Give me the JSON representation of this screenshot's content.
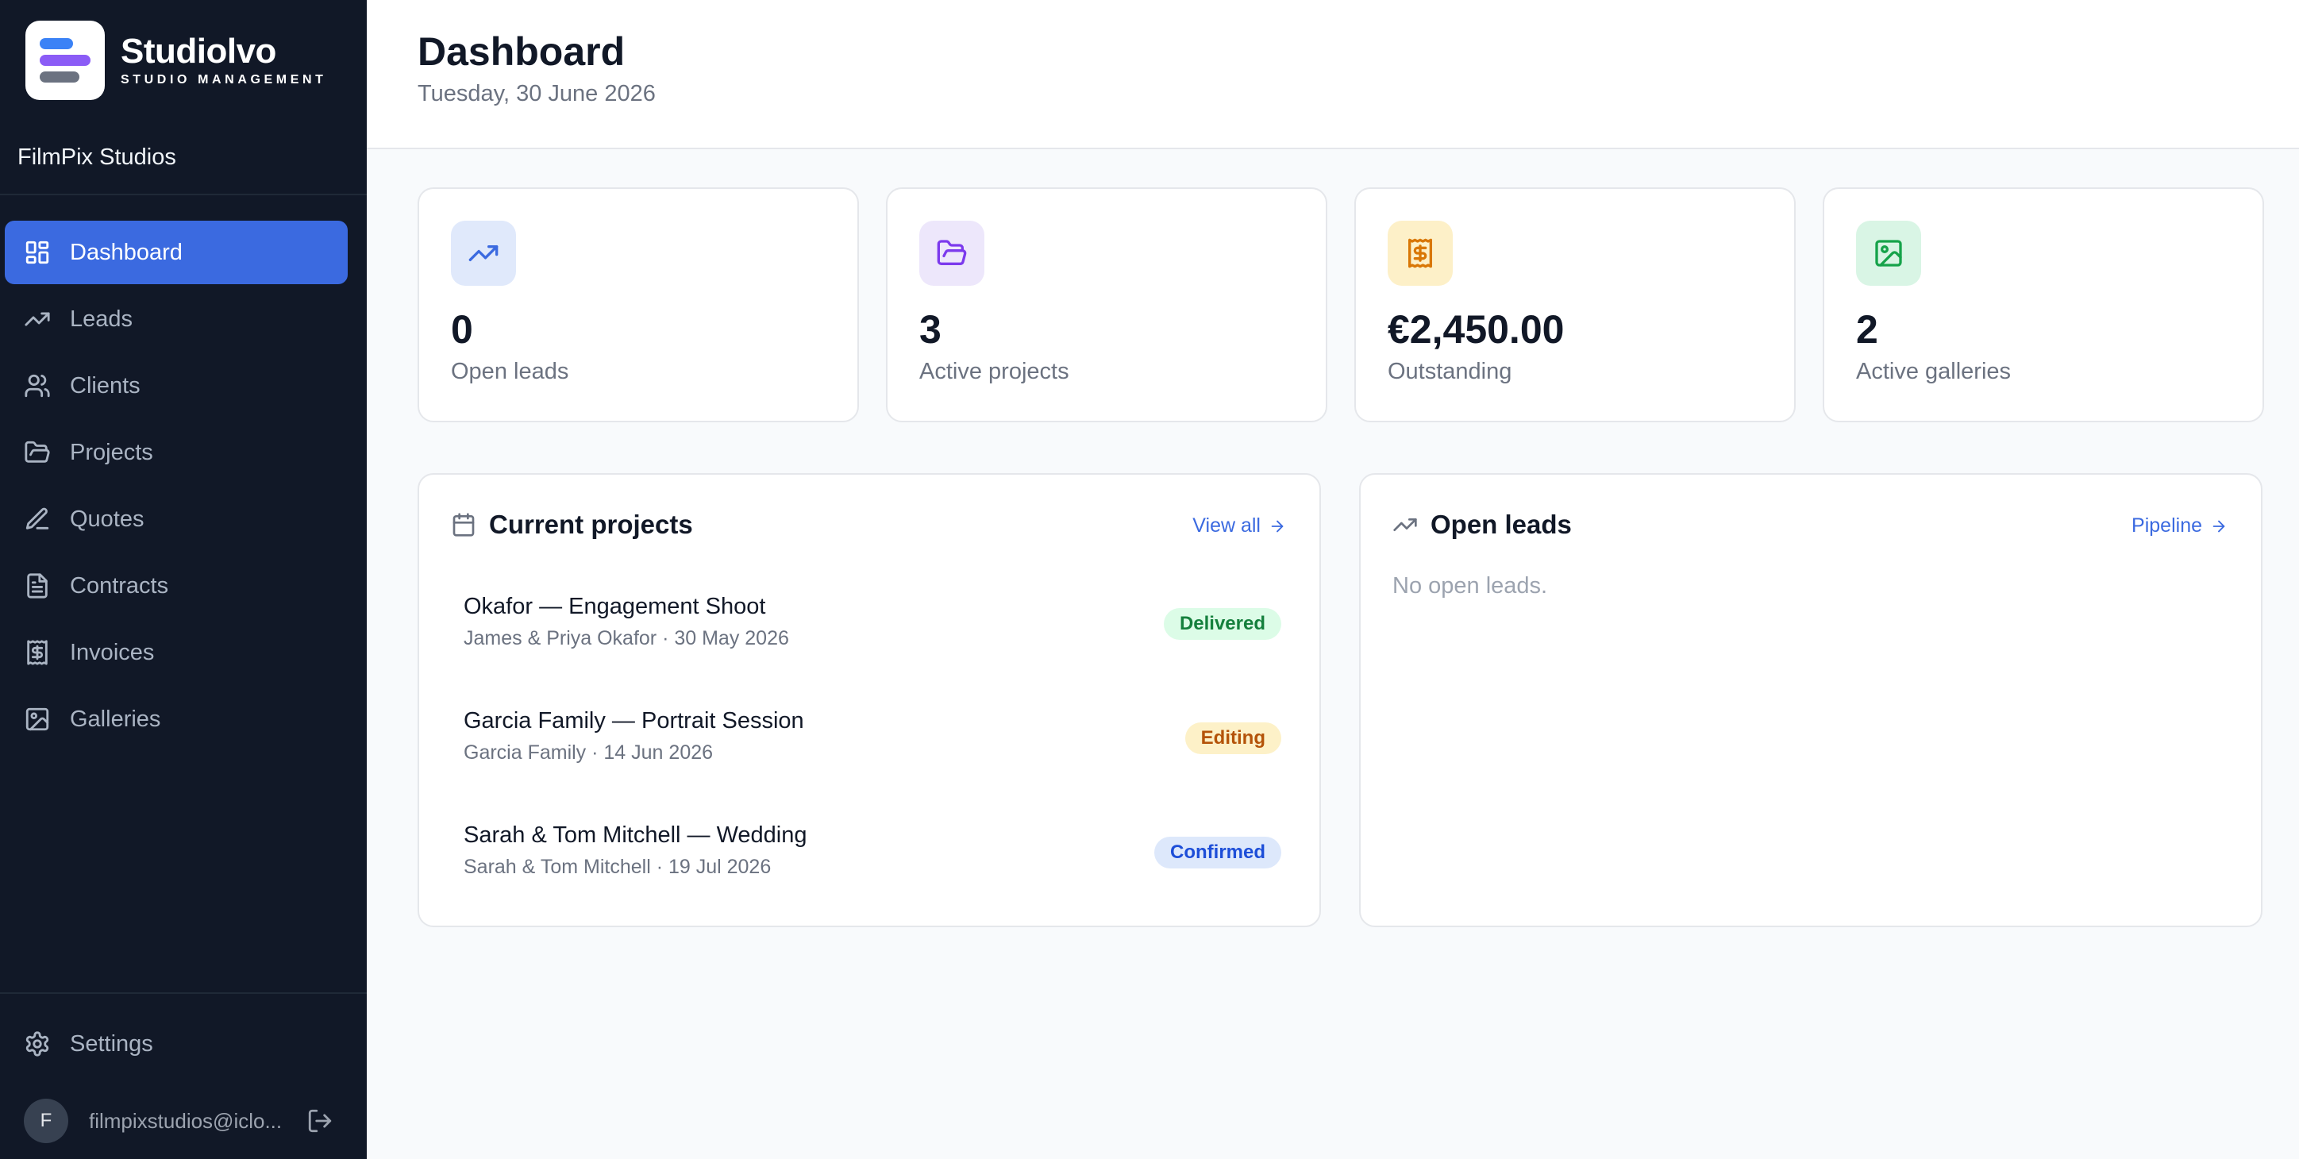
{
  "brand": {
    "name": "Studiolvo",
    "tagline": "STUDIO MANAGEMENT",
    "studio": "FilmPix Studios"
  },
  "nav": [
    {
      "label": "Dashboard",
      "icon": "grid-icon",
      "active": true
    },
    {
      "label": "Leads",
      "icon": "trending-up-icon"
    },
    {
      "label": "Clients",
      "icon": "users-icon"
    },
    {
      "label": "Projects",
      "icon": "folder-icon"
    },
    {
      "label": "Quotes",
      "icon": "pen-icon"
    },
    {
      "label": "Contracts",
      "icon": "document-icon"
    },
    {
      "label": "Invoices",
      "icon": "receipt-icon"
    },
    {
      "label": "Galleries",
      "icon": "image-icon"
    }
  ],
  "settings": {
    "label": "Settings",
    "icon": "gear-icon"
  },
  "user": {
    "initial": "F",
    "email": "filmpixstudios@iclo..."
  },
  "header": {
    "title": "Dashboard",
    "date": "Tuesday, 30 June 2026"
  },
  "stats": [
    {
      "value": "0",
      "label": "Open leads",
      "icon": "trending-up-icon",
      "bg": "#e0e9fb",
      "fg": "#3b6ae0"
    },
    {
      "value": "3",
      "label": "Active projects",
      "icon": "folder-open-icon",
      "bg": "#ede7fb",
      "fg": "#7c3aed"
    },
    {
      "value": "€2,450.00",
      "label": "Outstanding",
      "icon": "receipt-icon",
      "bg": "#fdf0c8",
      "fg": "#d97706"
    },
    {
      "value": "2",
      "label": "Active galleries",
      "icon": "image-icon",
      "bg": "#d9f5e5",
      "fg": "#16a34a"
    }
  ],
  "projects_panel": {
    "title": "Current projects",
    "link": "View all",
    "items": [
      {
        "title": "Okafor — Engagement Shoot",
        "sub": "James & Priya Okafor · 30 May 2026",
        "status": "Delivered",
        "badge_bg": "#dcfce7",
        "badge_fg": "#15803d"
      },
      {
        "title": "Garcia Family — Portrait Session",
        "sub": "Garcia Family · 14 Jun 2026",
        "status": "Editing",
        "badge_bg": "#fdf1c8",
        "badge_fg": "#b45309"
      },
      {
        "title": "Sarah & Tom Mitchell — Wedding",
        "sub": "Sarah & Tom Mitchell · 19 Jul 2026",
        "status": "Confirmed",
        "badge_bg": "#dde8fb",
        "badge_fg": "#1d4ed8"
      }
    ]
  },
  "leads_panel": {
    "title": "Open leads",
    "link": "Pipeline",
    "empty": "No open leads."
  }
}
